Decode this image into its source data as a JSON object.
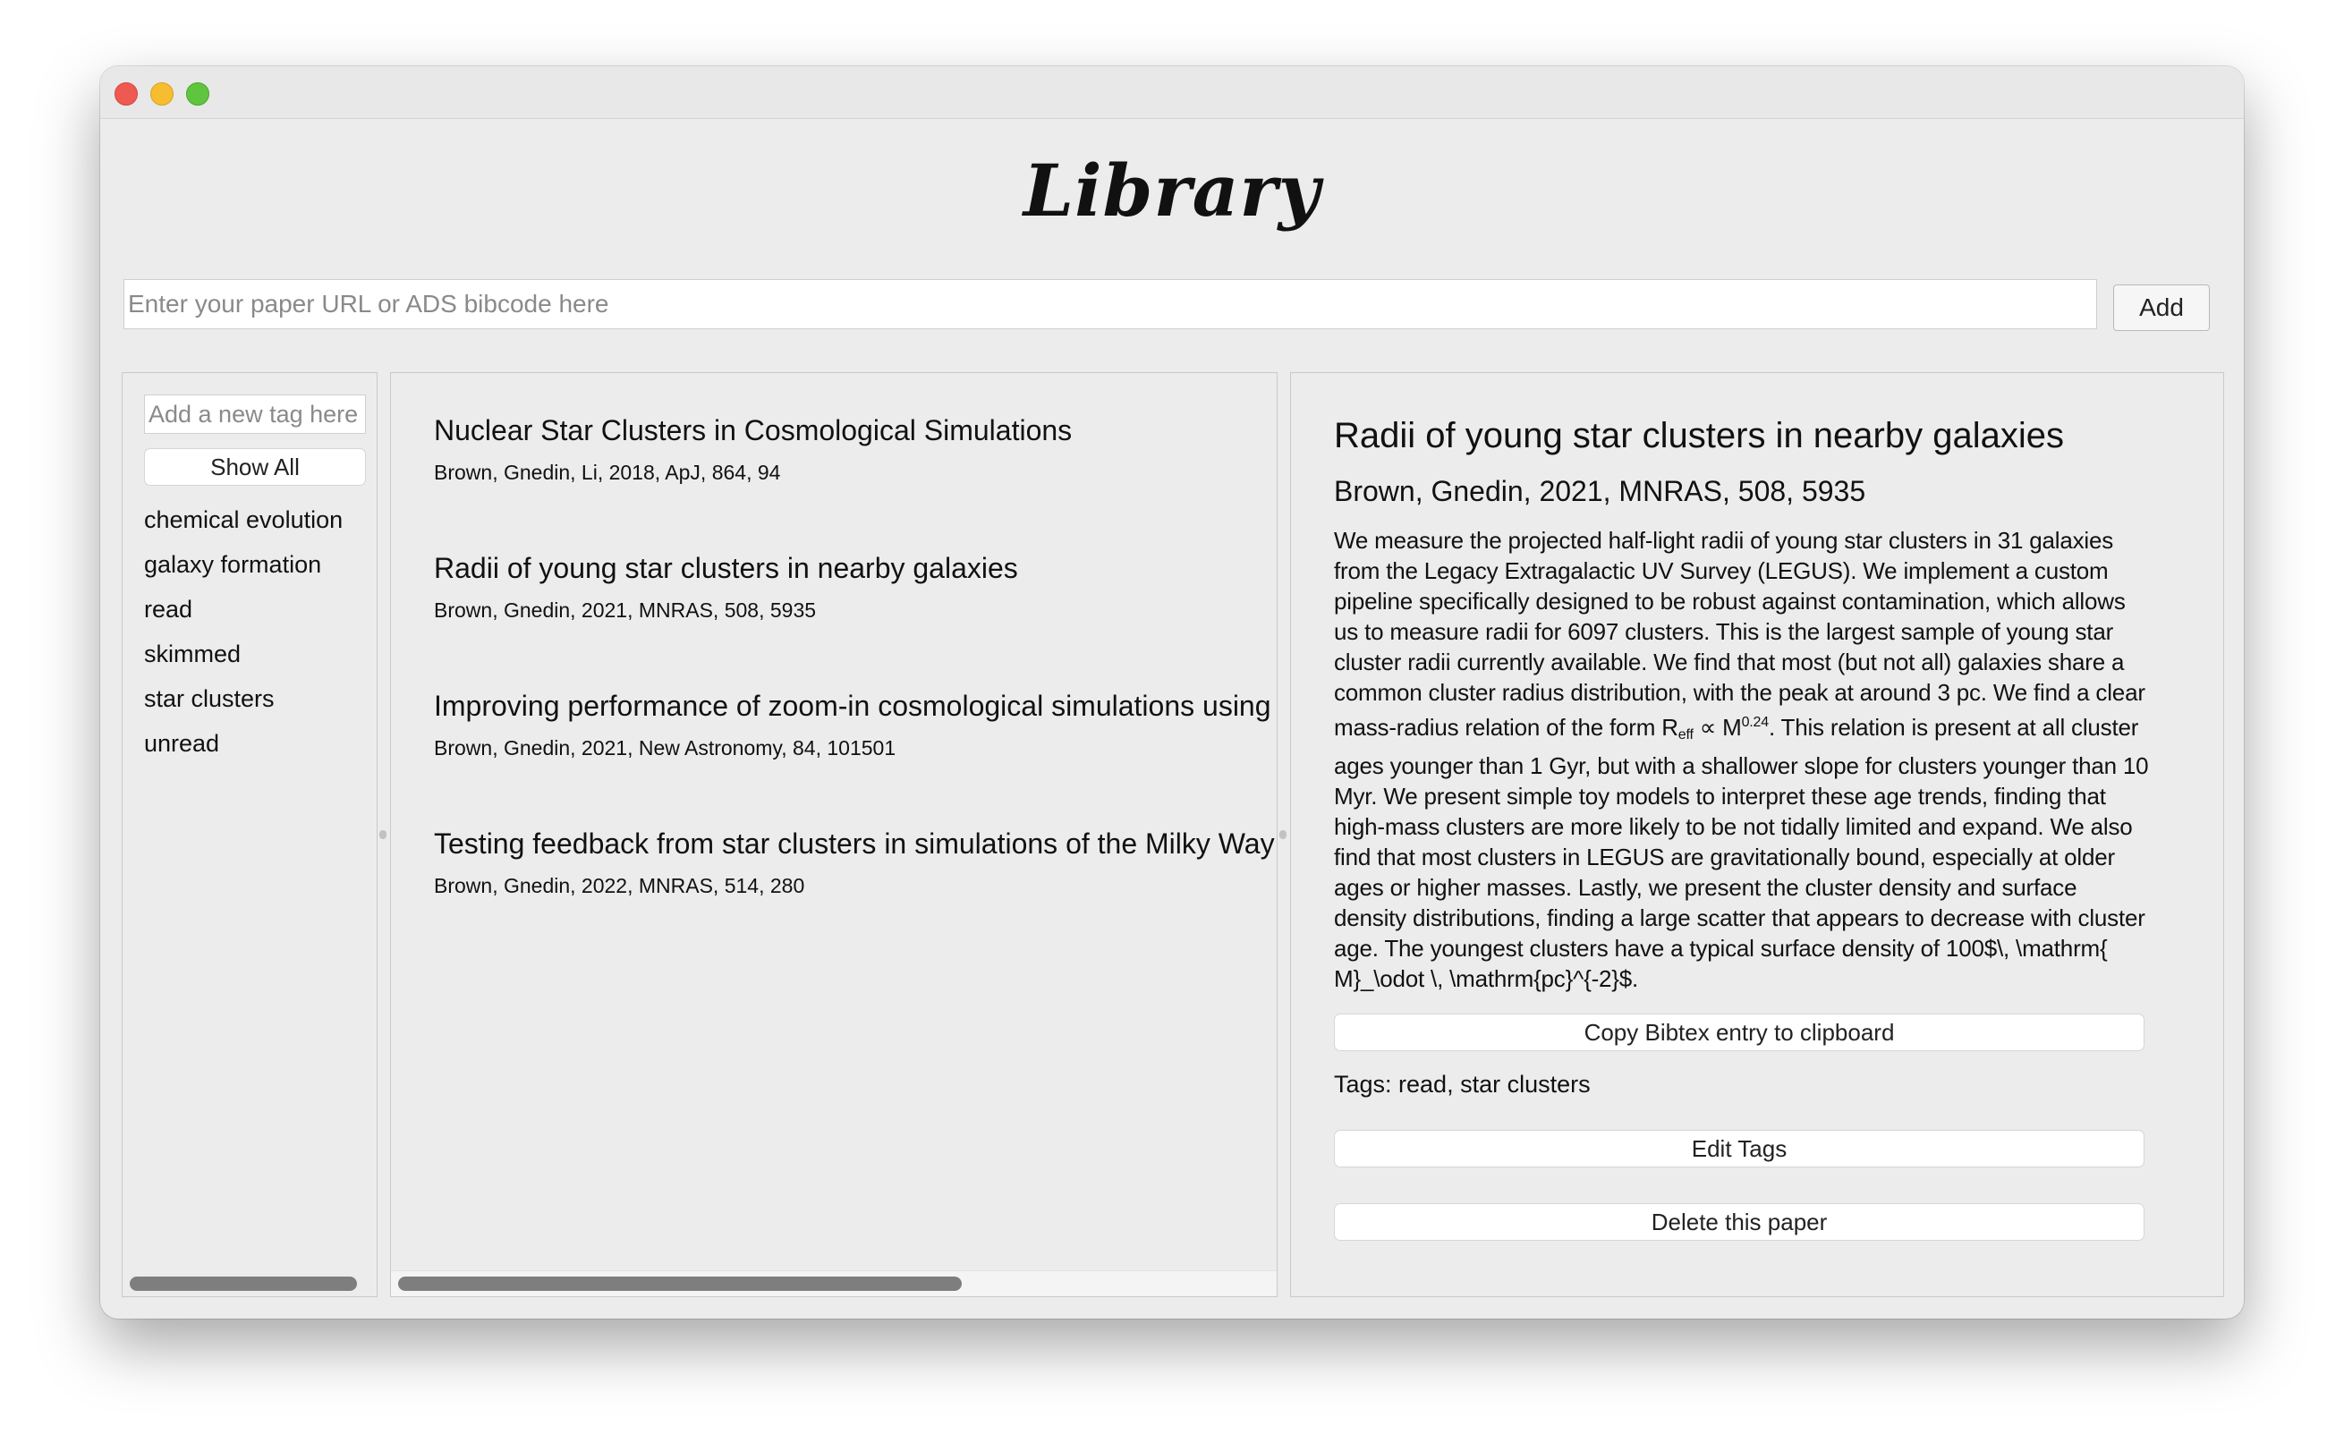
{
  "window": {
    "controls": [
      "close",
      "minimize",
      "zoom"
    ]
  },
  "header": {
    "title": "Library",
    "url_placeholder": "Enter your paper URL or ADS bibcode here",
    "add_label": "Add"
  },
  "tags_panel": {
    "new_tag_placeholder": "Add a new tag here",
    "show_all_label": "Show All",
    "tags": [
      {
        "label": "chemical evolution"
      },
      {
        "label": "galaxy formation"
      },
      {
        "label": "read"
      },
      {
        "label": "skimmed"
      },
      {
        "label": "star clusters"
      },
      {
        "label": "unread"
      }
    ]
  },
  "papers": [
    {
      "title": "Nuclear Star Clusters in Cosmological Simulations",
      "meta": "Brown, Gnedin, Li, 2018, ApJ, 864, 94"
    },
    {
      "title": "Radii of young star clusters in nearby galaxies",
      "meta": "Brown, Gnedin, 2021, MNRAS, 508, 5935"
    },
    {
      "title": "Improving performance of zoom-in cosmological simulations using ini",
      "meta": "Brown, Gnedin, 2021, New Astronomy, 84, 101501"
    },
    {
      "title": "Testing feedback from star clusters in simulations of the Milky Way for",
      "meta": "Brown, Gnedin, 2022, MNRAS, 514, 280"
    }
  ],
  "detail": {
    "title": "Radii of young star clusters in nearby galaxies",
    "meta": "Brown, Gnedin, 2021, MNRAS, 508, 5935",
    "abstract_part1": "We measure the projected half-light radii of young star clusters in 31 galaxies from the Legacy Extragalactic UV Survey (LEGUS). We implement a custom pipeline specifically designed to be robust against contamination, which allows us to measure radii for 6097 clusters. This is the largest sample of young star cluster radii currently available. We find that most (but not all) galaxies share a common cluster radius distribution, with the peak at around 3 pc. We find a clear mass-radius relation of the form R",
    "abstract_sub": "eff",
    "abstract_mid": " ∝ M",
    "abstract_sup": "0.24",
    "abstract_part2": ". This relation is present at all cluster ages younger than 1 Gyr, but with a shallower slope for clusters younger than 10 Myr. We present simple toy models to interpret these age trends, finding that high-mass clusters are more likely to be not tidally limited and expand. We also find that most clusters in LEGUS are gravitationally bound, especially at older ages or higher masses. Lastly, we present the cluster density and surface density distributions, finding a large scatter that appears to decrease with cluster age. The youngest clusters have a typical surface density of 100$\\, \\mathrm{ M}_\\odot \\, \\mathrm{pc}^{-2}$.",
    "copy_bibtex_label": "Copy Bibtex entry to clipboard",
    "tags_line": "Tags: read, star clusters",
    "edit_tags_label": "Edit Tags",
    "delete_label": "Delete this paper"
  }
}
